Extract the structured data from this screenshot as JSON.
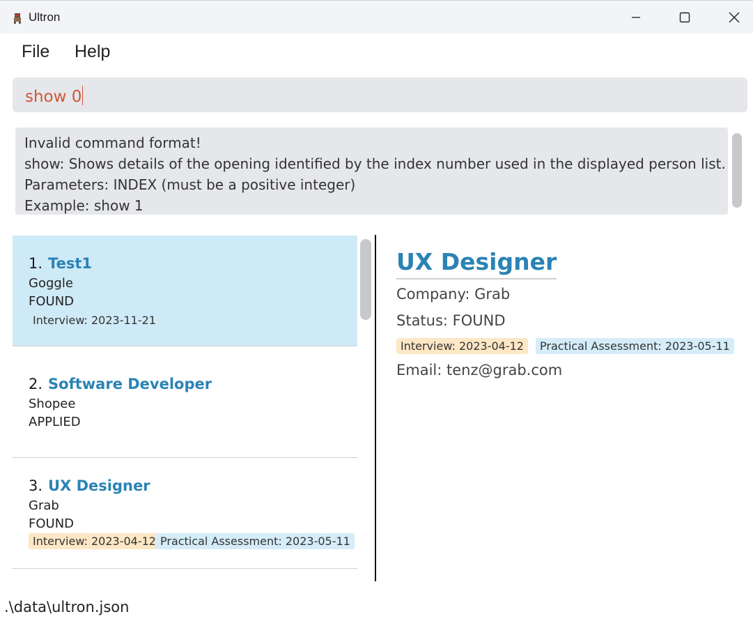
{
  "window": {
    "title": "Ultron",
    "icon": "app-icon",
    "controls": [
      "minimize-icon",
      "maximize-icon",
      "close-icon"
    ]
  },
  "menu": {
    "items": [
      {
        "label": "File"
      },
      {
        "label": "Help"
      }
    ]
  },
  "command": {
    "value": "show 0"
  },
  "result": {
    "lines": [
      "Invalid command format!",
      "show: Shows details of the opening identified by the index number used in the displayed person list.",
      "Parameters: INDEX (must be a positive integer)",
      "Example: show 1"
    ]
  },
  "list": {
    "cards": [
      {
        "index": "1.",
        "title": "Test1",
        "company": "Goggle",
        "status": "FOUND",
        "tags": [
          {
            "label": "Interview: 2023-11-21",
            "color": "#cfeaf7"
          }
        ],
        "selected": true
      },
      {
        "index": "2.",
        "title": "Software Developer",
        "company": "Shopee",
        "status": "APPLIED",
        "tags": [],
        "selected": false
      },
      {
        "index": "3.",
        "title": "UX Designer",
        "company": "Grab",
        "status": "FOUND",
        "tags": [
          {
            "label": "Interview: 2023-04-12",
            "color": "#fde7c5"
          },
          {
            "label": "Practical Assessment: 2023-05-11",
            "color": "#d5edf9"
          }
        ],
        "selected": false
      }
    ]
  },
  "detail": {
    "title": "UX Designer",
    "company": "Company: Grab",
    "status": "Status: FOUND",
    "tags": [
      {
        "label": "Interview: 2023-04-12",
        "color": "#fde7c5"
      },
      {
        "label": "Practical Assessment: 2023-05-11",
        "color": "#d5edf9"
      }
    ],
    "email": "Email: tenz@grab.com"
  },
  "status_bar": {
    "path": ".\\data\\ultron.json"
  },
  "colors": {
    "accent": "#2a83b4",
    "selected_card": "#cfeaf7",
    "command_text": "#d0573a"
  }
}
